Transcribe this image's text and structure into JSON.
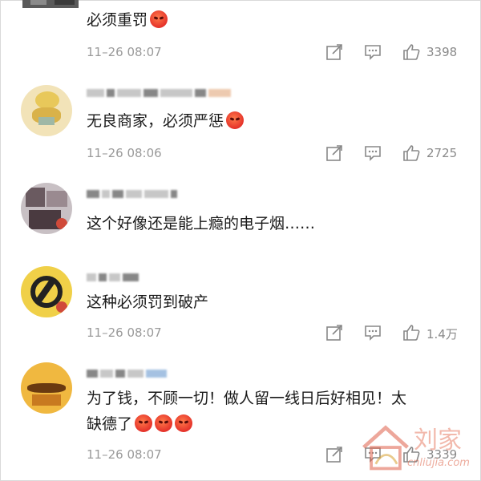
{
  "comments": [
    {
      "text": "必须重罚",
      "emojis": 1,
      "time": "11–26 08:07",
      "likes": "3398"
    },
    {
      "text": "无良商家，必须严惩",
      "emojis": 1,
      "time": "11–26 08:06",
      "likes": "2725"
    },
    {
      "text": "这个好像还是能上瘾的电子烟……",
      "emojis": 0
    },
    {
      "text": "这种必须罚到破产",
      "emojis": 0,
      "time": "11–26 08:07",
      "likes": "1.4万"
    },
    {
      "text_line1": "为了钱，不顾一切！做人留一线日后好相见！太",
      "text_line2": "缺德了",
      "emojis": 3,
      "time": "11–26 08:07",
      "likes": "3339"
    }
  ],
  "icons": {
    "share": "share-icon",
    "reply": "comment-icon",
    "like": "thumbs-up-icon",
    "emoji": "angry-face-emoji"
  },
  "watermark": {
    "cn": "刘家",
    "url": "cnliujia.com"
  },
  "colors": {
    "meta": "#9a9a9a",
    "text": "#1a1a1a",
    "emoji": "#e5322a"
  }
}
